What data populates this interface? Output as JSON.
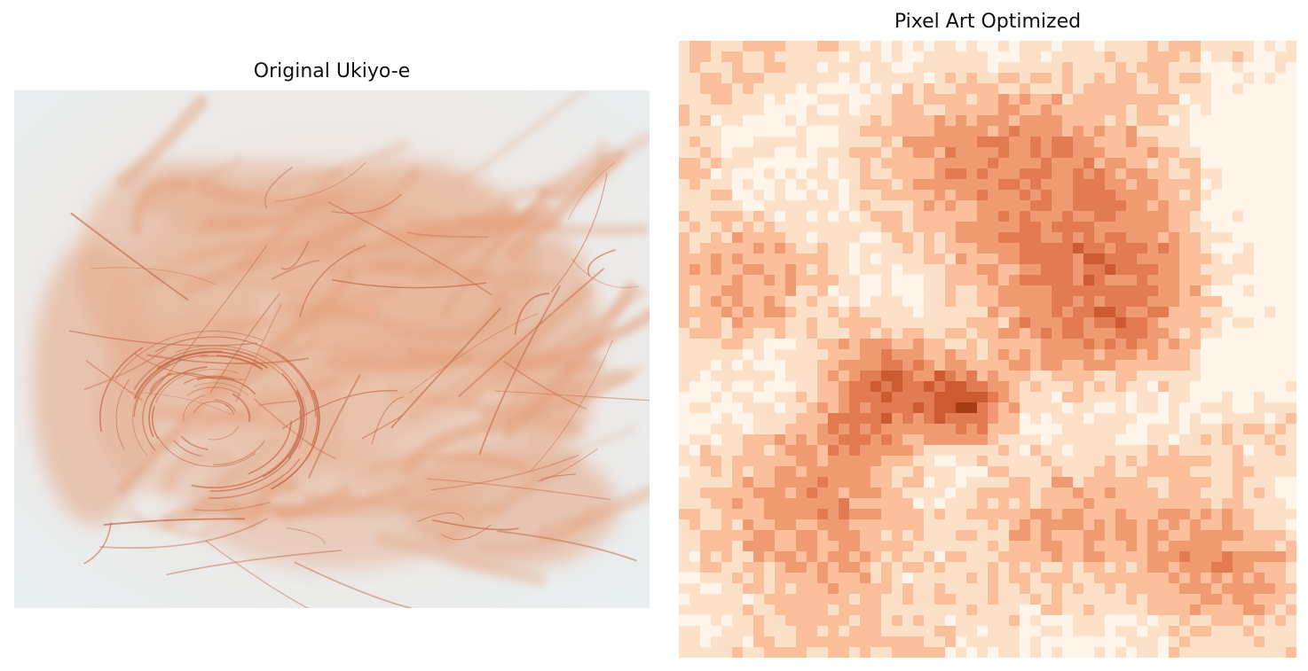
{
  "panels": {
    "left": {
      "title": "Original Ukiyo-e",
      "image_icon": "sketch-image",
      "palette": {
        "paper": "#ecf0f1",
        "wash": "#e4a27e",
        "line": "#c4704f"
      }
    },
    "right": {
      "title": "Pixel Art Optimized",
      "image_icon": "pixel-image",
      "grid": {
        "cols": 58,
        "rows": 58
      },
      "palette": [
        "#fff5eb",
        "#fde0c8",
        "#fbbf9c",
        "#f09a72",
        "#e37b52",
        "#cc5b32",
        "#a63c12"
      ]
    }
  }
}
